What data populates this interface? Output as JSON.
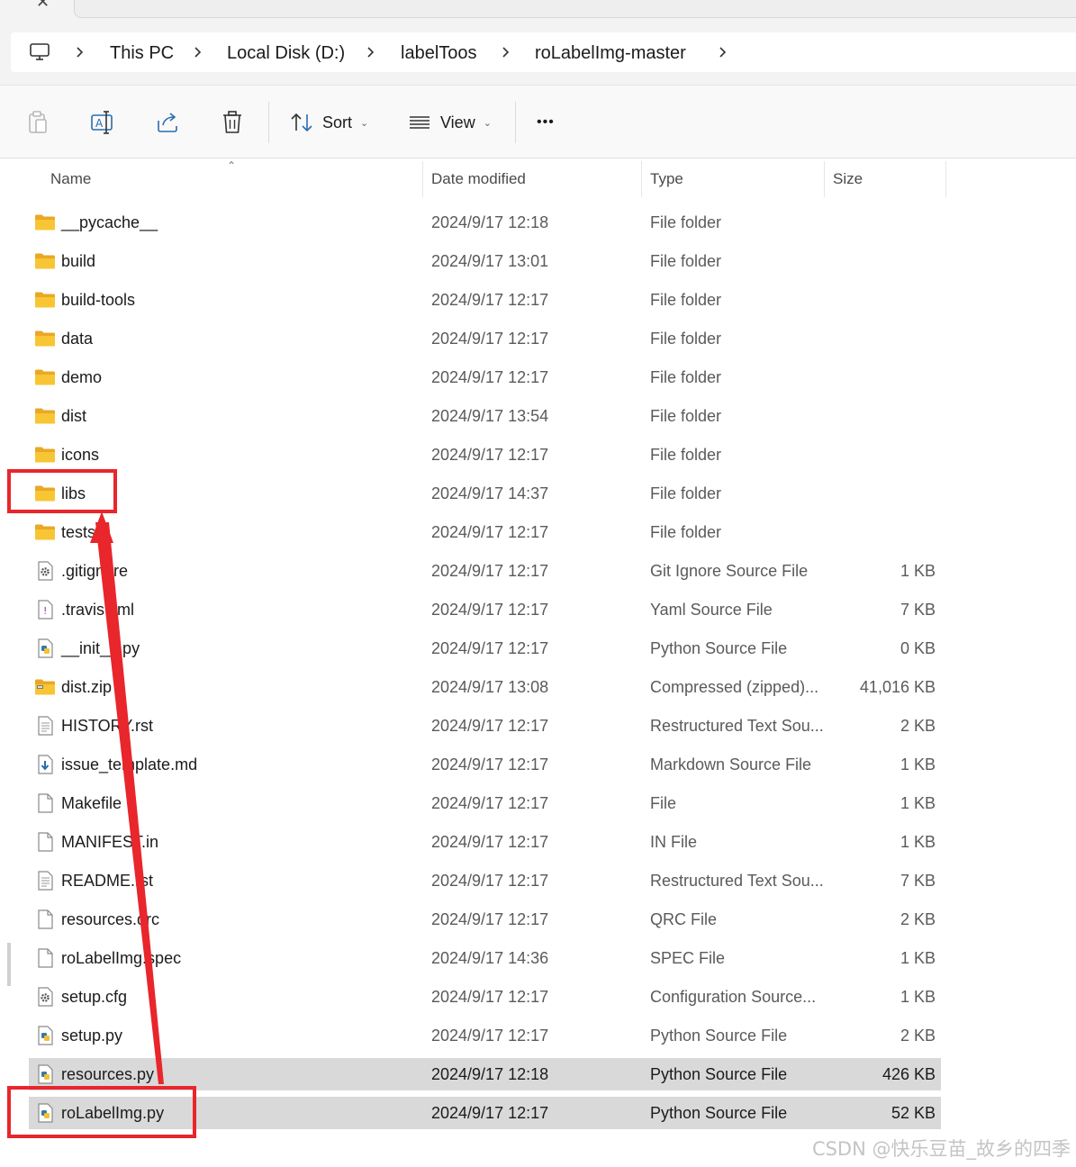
{
  "breadcrumb": {
    "icon": "computer-monitor-icon",
    "items": [
      "This PC",
      "Local Disk (D:)",
      "labelToos",
      "roLabelImg-master"
    ]
  },
  "toolbar": {
    "sort_label": "Sort",
    "view_label": "View",
    "more_label": "•••",
    "icons": [
      "paste-icon",
      "rename-icon",
      "share-icon",
      "delete-icon",
      "sort-icon",
      "view-icon"
    ]
  },
  "columns": {
    "name": "Name",
    "date": "Date modified",
    "type": "Type",
    "size": "Size"
  },
  "files": [
    {
      "name": "__pycache__",
      "date": "2024/9/17 12:18",
      "type": "File folder",
      "size": "",
      "icon": "folder"
    },
    {
      "name": "build",
      "date": "2024/9/17 13:01",
      "type": "File folder",
      "size": "",
      "icon": "folder"
    },
    {
      "name": "build-tools",
      "date": "2024/9/17 12:17",
      "type": "File folder",
      "size": "",
      "icon": "folder"
    },
    {
      "name": "data",
      "date": "2024/9/17 12:17",
      "type": "File folder",
      "size": "",
      "icon": "folder"
    },
    {
      "name": "demo",
      "date": "2024/9/17 12:17",
      "type": "File folder",
      "size": "",
      "icon": "folder"
    },
    {
      "name": "dist",
      "date": "2024/9/17 13:54",
      "type": "File folder",
      "size": "",
      "icon": "folder"
    },
    {
      "name": "icons",
      "date": "2024/9/17 12:17",
      "type": "File folder",
      "size": "",
      "icon": "folder"
    },
    {
      "name": "libs",
      "date": "2024/9/17 14:37",
      "type": "File folder",
      "size": "",
      "icon": "folder"
    },
    {
      "name": "tests",
      "date": "2024/9/17 12:17",
      "type": "File folder",
      "size": "",
      "icon": "folder"
    },
    {
      "name": ".gitignore",
      "date": "2024/9/17 12:17",
      "type": "Git Ignore Source File",
      "size": "1 KB",
      "icon": "gear"
    },
    {
      "name": ".travis.yml",
      "date": "2024/9/17 12:17",
      "type": "Yaml Source File",
      "size": "7 KB",
      "icon": "yaml"
    },
    {
      "name": "__init__.py",
      "date": "2024/9/17 12:17",
      "type": "Python Source File",
      "size": "0 KB",
      "icon": "python"
    },
    {
      "name": "dist.zip",
      "date": "2024/9/17 13:08",
      "type": "Compressed (zipped)...",
      "size": "41,016 KB",
      "icon": "zip"
    },
    {
      "name": "HISTORY.rst",
      "date": "2024/9/17 12:17",
      "type": "Restructured Text Sou...",
      "size": "2 KB",
      "icon": "text"
    },
    {
      "name": "issue_template.md",
      "date": "2024/9/17 12:17",
      "type": "Markdown Source File",
      "size": "1 KB",
      "icon": "markdown"
    },
    {
      "name": "Makefile",
      "date": "2024/9/17 12:17",
      "type": "File",
      "size": "1 KB",
      "icon": "blank"
    },
    {
      "name": "MANIFEST.in",
      "date": "2024/9/17 12:17",
      "type": "IN File",
      "size": "1 KB",
      "icon": "blank"
    },
    {
      "name": "README.rst",
      "date": "2024/9/17 12:17",
      "type": "Restructured Text Sou...",
      "size": "7 KB",
      "icon": "text"
    },
    {
      "name": "resources.qrc",
      "date": "2024/9/17 12:17",
      "type": "QRC File",
      "size": "2 KB",
      "icon": "blank"
    },
    {
      "name": "roLabelImg.spec",
      "date": "2024/9/17 14:36",
      "type": "SPEC File",
      "size": "1 KB",
      "icon": "blank"
    },
    {
      "name": "setup.cfg",
      "date": "2024/9/17 12:17",
      "type": "Configuration Source...",
      "size": "1 KB",
      "icon": "gear"
    },
    {
      "name": "setup.py",
      "date": "2024/9/17 12:17",
      "type": "Python Source File",
      "size": "2 KB",
      "icon": "python"
    },
    {
      "name": "resources.py",
      "date": "2024/9/17 12:18",
      "type": "Python Source File",
      "size": "426 KB",
      "icon": "python",
      "selected": true
    },
    {
      "name": "roLabelImg.py",
      "date": "2024/9/17 12:17",
      "type": "Python Source File",
      "size": "52 KB",
      "icon": "python",
      "selected": true
    }
  ],
  "annotation": {
    "color": "#e8262b",
    "from_file": "roLabelImg.py",
    "to_file": "libs"
  },
  "watermark": "CSDN @快乐豆苗_故乡的四季",
  "colors": {
    "folder": "#f8c534",
    "selection": "#d9d9d9",
    "python_icon": "#3b77a8"
  }
}
